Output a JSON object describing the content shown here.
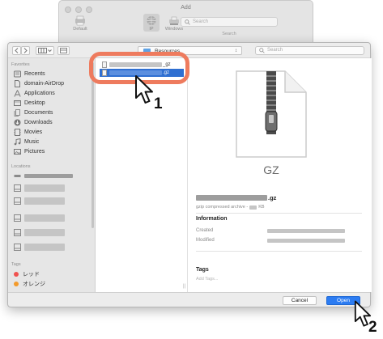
{
  "background_window": {
    "title": "Add",
    "tools": [
      {
        "label": "Default",
        "icon": "printer-icon"
      },
      {
        "label": "IP",
        "icon": "globe-icon"
      },
      {
        "label": "Windows",
        "icon": "windows-printer-icon"
      }
    ],
    "search_placeholder": "Search",
    "search_label": "Search"
  },
  "toolbar": {
    "back_icon": "chevron-left-icon",
    "forward_icon": "chevron-right-icon",
    "view_icon": "column-view-icon",
    "group_icon": "group-icon",
    "location": "Resources",
    "location_folder_color": "#5ea2e5",
    "search_placeholder": "Search"
  },
  "sidebar": {
    "favorites_heading": "Favorites",
    "favorites": [
      {
        "label": "Recents",
        "icon": "clock-icon"
      },
      {
        "label": "domain-AirDrop",
        "icon": "document-icon"
      },
      {
        "label": "Applications",
        "icon": "applications-icon"
      },
      {
        "label": "Desktop",
        "icon": "desktop-icon"
      },
      {
        "label": "Documents",
        "icon": "documents-icon"
      },
      {
        "label": "Downloads",
        "icon": "downloads-icon"
      },
      {
        "label": "Movies",
        "icon": "film-icon"
      },
      {
        "label": "Music",
        "icon": "music-note-icon"
      },
      {
        "label": "Pictures",
        "icon": "pictures-icon"
      }
    ],
    "locations_heading": "Locations",
    "tags_heading": "Tags",
    "tags": [
      {
        "label": "レッド",
        "color": "#f0524f"
      },
      {
        "label": "オレンジ",
        "color": "#f39a2b"
      }
    ]
  },
  "files": [
    {
      "suffix": "_gz"
    },
    {
      "suffix": ".gz",
      "selected": true
    }
  ],
  "preview": {
    "type_label": "GZ",
    "name_suffix": ".gz",
    "kind_prefix": "gzip compressed archive - ",
    "kind_suffix": " KB",
    "information_heading": "Information",
    "created_label": "Created",
    "modified_label": "Modified",
    "tags_heading": "Tags",
    "add_tags_placeholder": "Add Tags..."
  },
  "buttons": {
    "cancel": "Cancel",
    "open": "Open"
  },
  "annotations": {
    "step1": "1",
    "step2": "2",
    "highlight_color": "#ee7b5e"
  },
  "colors": {
    "selection_blue": "#2f6fd1",
    "open_button_blue": "#2c7cf2"
  }
}
